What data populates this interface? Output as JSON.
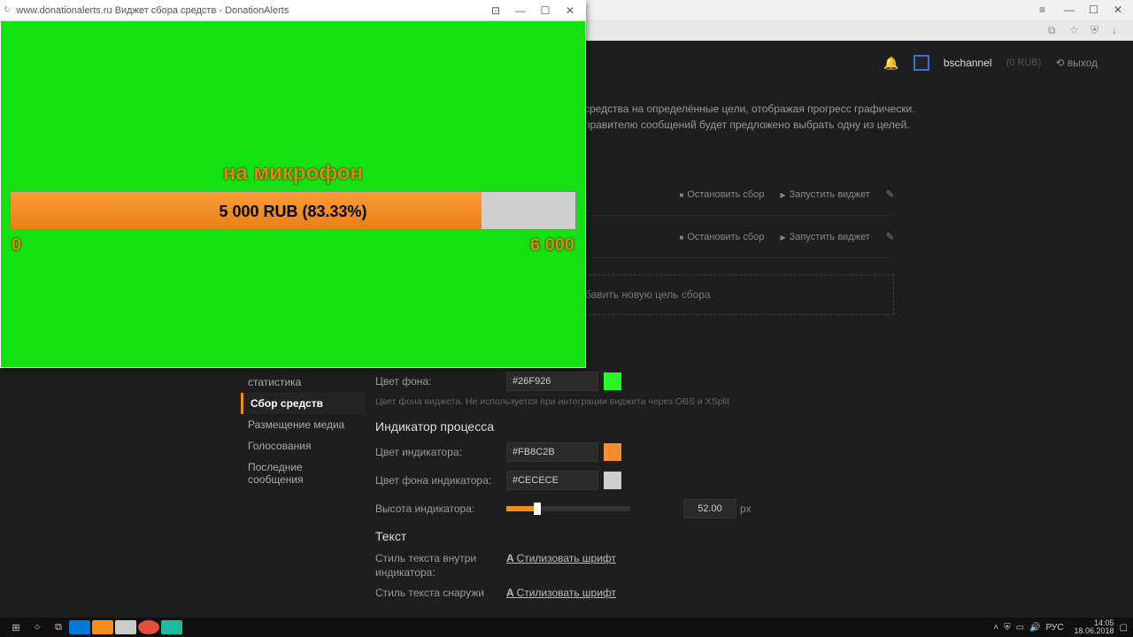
{
  "os_top": {
    "min": "—",
    "max": "☐",
    "close": "✕",
    "menu": "≡"
  },
  "ext_row": {
    "book": "⧉",
    "star": "☆",
    "shield": "⛨",
    "dl": "↓"
  },
  "app_header": {
    "username": "bschannel",
    "balance": "(0 RUB)",
    "logout": "выход",
    "logout_icon": "⟲"
  },
  "description": {
    "line1": "средства на определённые цели, отображая прогресс графически.",
    "line2": "правителю сообщений будет предложено выбрать одну из целей."
  },
  "goals": {
    "stop": "Остановить сбор",
    "run": "Запустить виджет",
    "edit": "✎"
  },
  "add_goal": "бавить новую цель сбора",
  "sidebar": {
    "items": [
      {
        "label": "статистика"
      },
      {
        "label": "Сбор средств"
      },
      {
        "label": "Размещение медиа"
      },
      {
        "label": "Голосования"
      },
      {
        "label": "Последние сообщения"
      }
    ]
  },
  "settings": {
    "bg_label": "Цвет фона:",
    "bg_value": "#26F926",
    "bg_hint": "Цвет фона виджета. Не используется при интеграции виджета через OBS и XSplit",
    "indicator_section": "Индикатор процесса",
    "ind_color_label": "Цвет индикатора:",
    "ind_color_value": "#FB8C2B",
    "ind_bg_label": "Цвет фона индикатора:",
    "ind_bg_value": "#CECECE",
    "ind_h_label": "Высота индикатора:",
    "ind_h_value": "52.00",
    "ind_h_unit": "px",
    "text_section": "Текст",
    "txt_inside_label": "Стиль текста внутри индикатора:",
    "txt_outside_label": "Стиль текста снаружи",
    "style_link": "Стилизовать шрифт"
  },
  "popup": {
    "url": "www.donationalerts.ru",
    "title": "Виджет сбора средств - DonationAlerts",
    "min": "—",
    "max": "☐",
    "close": "✕",
    "lock": "⊡"
  },
  "widget": {
    "goal_title": "на микрофон",
    "progress_text": "5 000 RUB (83.33%)",
    "progress_pct": 83.33,
    "scale_min": "0",
    "scale_max": "6 000"
  },
  "taskbar": {
    "win": "⊞",
    "search": "○",
    "tasks": "⧉",
    "lang": "РУС",
    "time": "14:05",
    "date": "18.06.2018",
    "up": "˄",
    "net": "▭",
    "vol": "🔊",
    "shield": "⛨",
    "not": "▢"
  },
  "colors": {
    "bg_swatch": "#26F926",
    "ind_swatch": "#FB8C2B",
    "ind_bg_swatch": "#CECECE"
  }
}
